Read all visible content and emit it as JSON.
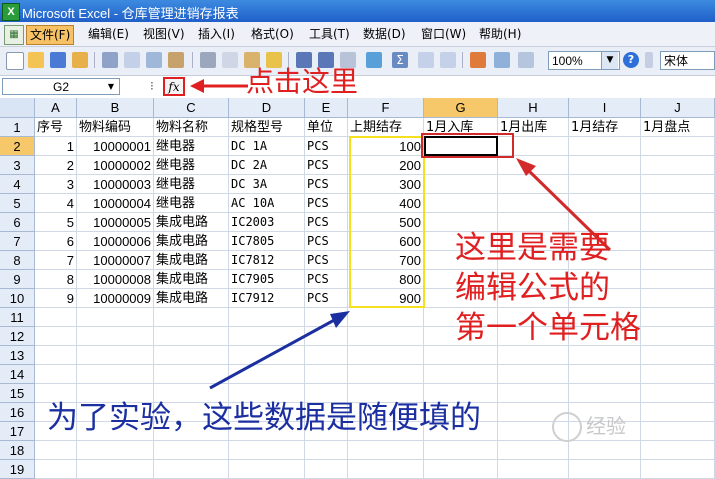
{
  "titlebar": {
    "title": "Microsoft Excel - 仓库管理进销存报表"
  },
  "menubar": {
    "items": [
      "文件(F)",
      "编辑(E)",
      "视图(V)",
      "插入(I)",
      "格式(O)",
      "工具(T)",
      "数据(D)",
      "窗口(W)",
      "帮助(H)"
    ]
  },
  "toolbar": {
    "zoom_value": "100%",
    "font_value": "宋体"
  },
  "formula_bar": {
    "name_box": "G2",
    "fx_label": "fx",
    "formula": ""
  },
  "sheet": {
    "columns": [
      "A",
      "B",
      "C",
      "D",
      "E",
      "F",
      "G",
      "H",
      "I",
      "J"
    ],
    "selected_column": "G",
    "selected_row": 2,
    "header_row": [
      "序号",
      "物料编码",
      "物料名称",
      "规格型号",
      "单位",
      "上期结存",
      "1月入库",
      "1月出库",
      "1月结存",
      "1月盘点"
    ],
    "rows": [
      {
        "a": "1",
        "b": "10000001",
        "c": "继电器",
        "d": "DC 1A",
        "e": "PCS",
        "f": "100"
      },
      {
        "a": "2",
        "b": "10000002",
        "c": "继电器",
        "d": "DC 2A",
        "e": "PCS",
        "f": "200"
      },
      {
        "a": "3",
        "b": "10000003",
        "c": "继电器",
        "d": "DC 3A",
        "e": "PCS",
        "f": "300"
      },
      {
        "a": "4",
        "b": "10000004",
        "c": "继电器",
        "d": "AC 10A",
        "e": "PCS",
        "f": "400"
      },
      {
        "a": "5",
        "b": "10000005",
        "c": "集成电路",
        "d": "IC2003",
        "e": "PCS",
        "f": "500"
      },
      {
        "a": "6",
        "b": "10000006",
        "c": "集成电路",
        "d": "IC7805",
        "e": "PCS",
        "f": "600"
      },
      {
        "a": "7",
        "b": "10000007",
        "c": "集成电路",
        "d": "IC7812",
        "e": "PCS",
        "f": "700"
      },
      {
        "a": "8",
        "b": "10000008",
        "c": "集成电路",
        "d": "IC7905",
        "e": "PCS",
        "f": "800"
      },
      {
        "a": "9",
        "b": "10000009",
        "c": "集成电路",
        "d": "IC7912",
        "e": "PCS",
        "f": "900"
      }
    ],
    "row_numbers": [
      "1",
      "2",
      "3",
      "4",
      "5",
      "6",
      "7",
      "8",
      "9",
      "10",
      "11",
      "12",
      "13",
      "14",
      "15",
      "16",
      "17",
      "18",
      "19"
    ]
  },
  "annotations": {
    "top": "点击这里",
    "right": [
      "这里是需要",
      "编辑公式的",
      "第一个单元格"
    ],
    "bottom": "为了实验，这些数据是随便填的",
    "watermark": "经验"
  },
  "colors": {
    "red_annotation": "#e02020",
    "blue_annotation": "#1b2fa0",
    "yellow_box": "#f5e020",
    "selected_header": "#f6c86a"
  }
}
